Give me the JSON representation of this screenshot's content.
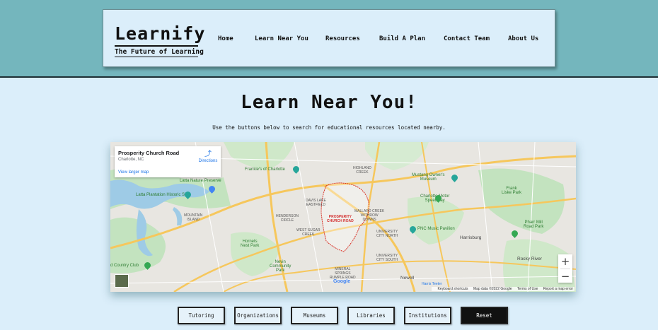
{
  "brand": {
    "title": "Learnify",
    "tagline": "The Future of Learning"
  },
  "nav": [
    "Home",
    "Learn Near You",
    "Resources",
    "Build A Plan",
    "Contact Team",
    "About Us"
  ],
  "page": {
    "heading": "Learn Near You!",
    "intro": "Use the buttons below to search for educational resources located nearby."
  },
  "map": {
    "place_name": "Prosperity Church Road",
    "place_city": "Charlotte, NC",
    "larger_map": "View larger map",
    "directions": "Directions",
    "zoom_in": "+",
    "zoom_out": "−",
    "google": "Google",
    "attribution": [
      "Keyboard shortcuts",
      "Map data ©2022 Google",
      "Terms of Use",
      "Report a map error"
    ],
    "labels": {
      "frankies": "Frankie's of Charlotte",
      "latta_preserve": "Latta Nature Preserve",
      "latta_plantation": "Latta Plantation Historic Site",
      "mountain_island": "MOUNTAIN\nISLAND",
      "henderson": "HENDERSON\nCIRCLE",
      "davis_lake": "DAVIS LAKE\nEASTFIELD",
      "highland": "HIGHLAND\nCREEK",
      "mallard": "MALLARD CREEK\nWITHROW\nDOWNS",
      "west_sugar": "WEST SUGAR\nCREEK",
      "prosperity": "PROSPERITY\nCHURCH ROAD",
      "university": "UNIVERSITY\nCITY NORTH",
      "university_south": "UNIVERSITY\nCITY SOUTH",
      "mustang": "Mustang Owner's\nMuseum",
      "motor_speedway": "Charlotte Motor\nSpeedway",
      "frank_liske": "Frank\nLiske Park",
      "pnc": "PNC Music Pavilion",
      "harrisburg": "Harrisburg",
      "pharr_mill": "Pharr Mill\nRoad Park",
      "hornets": "Hornets\nNest Park",
      "nevin": "Nevin\nCommunity\nPark",
      "mineral": "MINERAL\nSPRINGS\nRUMPLE ROAD",
      "newell": "Newell",
      "rocky_river": "Rocky River",
      "country_club": "d Country Club",
      "harris_teeter": "Harris Teeter"
    }
  },
  "buttons": [
    "Tutoring",
    "Organizations",
    "Museums",
    "Libraries",
    "Institutions",
    "Reset"
  ],
  "colors": {
    "band": "#74b6bd",
    "page_bg": "#dbeefa",
    "reset_bg": "#111111"
  }
}
